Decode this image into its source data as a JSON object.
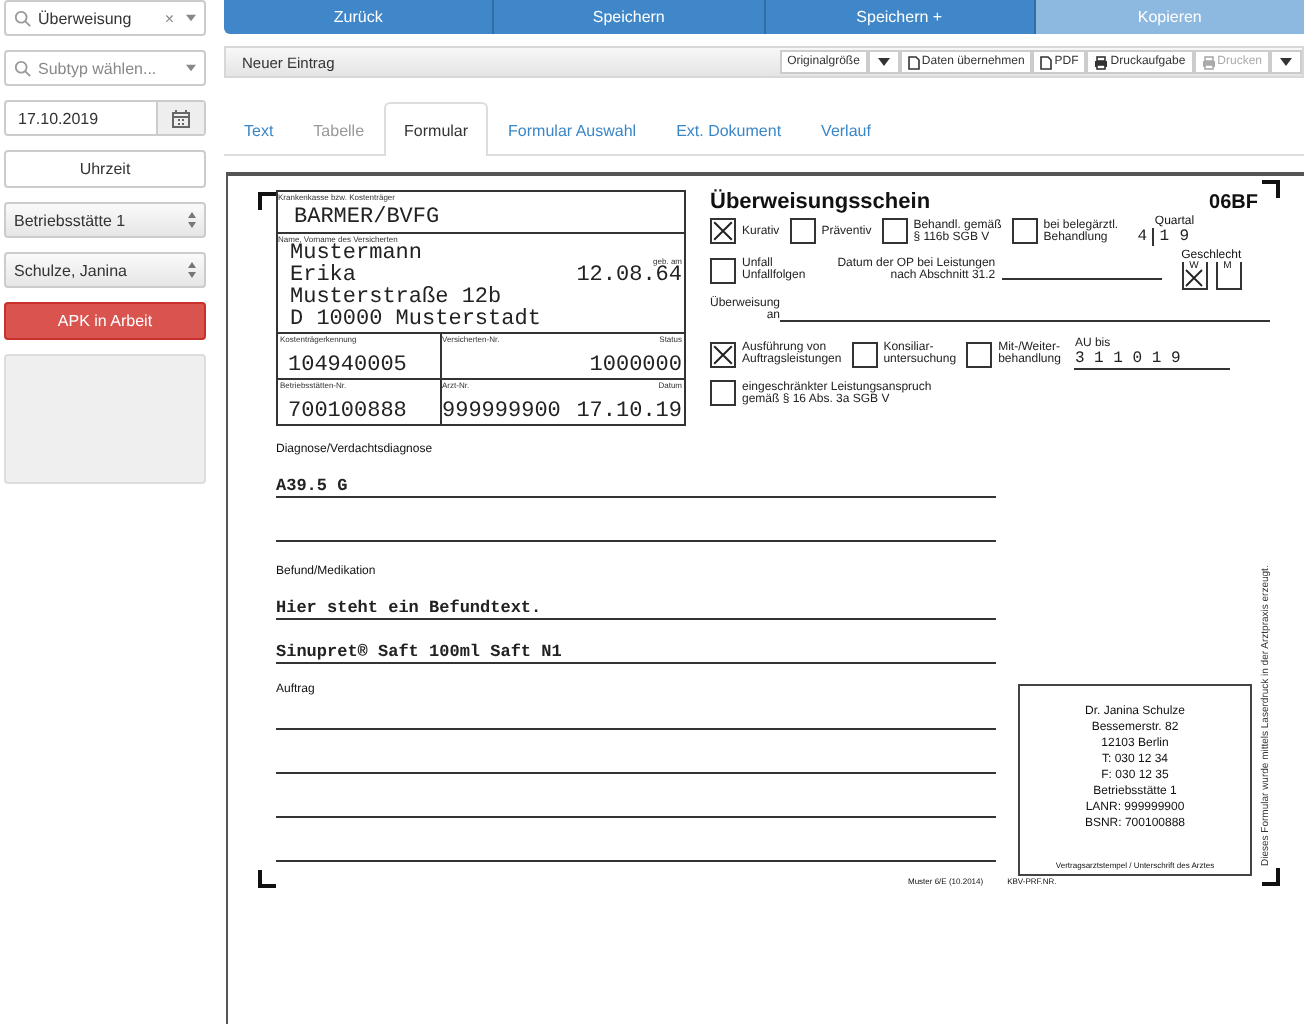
{
  "sidebar": {
    "type_select": {
      "value": "Überweisung",
      "clear": "×"
    },
    "subtype_select": {
      "placeholder": "Subtyp wählen..."
    },
    "date_field": {
      "value": "17.10.2019"
    },
    "time_button": "Uhrzeit",
    "location_select": "Betriebsstätte 1",
    "doctor_select": "Schulze, Janina",
    "status_button": "APK in Arbeit"
  },
  "action_buttons": [
    {
      "label": "Zurück",
      "disabled": false
    },
    {
      "label": "Speichern",
      "disabled": false
    },
    {
      "label": "Speichern +",
      "disabled": false
    },
    {
      "label": "Kopieren",
      "disabled": true
    }
  ],
  "toolbar": {
    "title": "Neuer Eintrag",
    "buttons": [
      {
        "label": "Originalgröße",
        "kind": "plain",
        "disabled": false
      },
      {
        "kind": "caret"
      },
      {
        "label": "Daten übernehmen",
        "kind": "document",
        "disabled": false
      },
      {
        "label": "PDF",
        "kind": "document",
        "disabled": false
      },
      {
        "label": "Druckaufgabe",
        "kind": "printer",
        "disabled": false
      },
      {
        "label": "Drucken",
        "kind": "printer",
        "disabled": true
      },
      {
        "kind": "caret"
      }
    ]
  },
  "tabs": [
    {
      "label": "Text",
      "selected": false,
      "disabled": false
    },
    {
      "label": "Tabelle",
      "selected": false,
      "disabled": true
    },
    {
      "label": "Formular",
      "selected": true,
      "disabled": false
    },
    {
      "label": "Formular Auswahl",
      "selected": false,
      "disabled": false
    },
    {
      "label": "Ext. Dokument",
      "selected": false,
      "disabled": false
    },
    {
      "label": "Verlauf",
      "selected": false,
      "disabled": false
    }
  ],
  "form": {
    "insurer_label": "Krankenkasse bzw. Kostenträger",
    "insurer": "BARMER/BVFG",
    "name_label": "Name, Vorname des Versicherten",
    "name_lines": [
      "Mustermann",
      "Erika",
      "Musterstraße 12b",
      "D 10000 Musterstadt"
    ],
    "dob_label": "geb. am",
    "dob": "12.08.64",
    "id_rows": [
      [
        {
          "label": "Kostenträgerkennung",
          "value": "104940005"
        },
        {
          "label": "Versicherten-Nr."
        },
        {
          "label": "Status",
          "value": "1000000"
        }
      ],
      [
        {
          "label": "Betriebsstätten-Nr.",
          "value": "700100888"
        },
        {
          "label": "Arzt-Nr.",
          "value": "999999900"
        },
        {
          "label": "Datum",
          "value": "17.10.19"
        }
      ]
    ],
    "title": "Überweisungsschein",
    "code": "06BF",
    "treatment": [
      {
        "label": "Kurativ",
        "checked": true
      },
      {
        "label": "Präventiv",
        "checked": false
      },
      {
        "label": "Behandl. gemäß\n§ 116b SGB V",
        "checked": false
      },
      {
        "label": "bei belegärztl.\nBehandlung",
        "checked": false
      }
    ],
    "quarter_label": "Quartal",
    "quarter": [
      "4",
      "1",
      "9"
    ],
    "accident": {
      "label": "Unfall\nUnfallfolgen",
      "checked": false
    },
    "op_date_label": "Datum der OP bei Leistungen\nnach Abschnitt 31.2",
    "gender_label": "Geschlecht",
    "gender": [
      {
        "label": "W",
        "checked": true
      },
      {
        "label": "M",
        "checked": false
      }
    ],
    "referral_label": "Überweisung\nan",
    "referral_type": [
      {
        "label": "Ausführung von\nAuftragsleistungen",
        "checked": true
      },
      {
        "label": "Konsiliar-\nuntersuchung",
        "checked": false
      },
      {
        "label": "Mit-/Weiter-\nbehandlung",
        "checked": false
      }
    ],
    "au_label": "AU bis",
    "au": "3 1 1 0 1 9",
    "restricted": {
      "label": "eingeschränkter Leistungsanspruch\ngemäß § 16 Abs. 3a SGB V",
      "checked": false
    },
    "diagnosis_label": "Diagnose/Verdachtsdiagnose",
    "diagnosis_lines": [
      "A39.5 G"
    ],
    "findings_label": "Befund/Medikation",
    "findings_lines": [
      "Hier steht ein Befundtext.",
      "Sinupret® Saft 100ml Saft N1"
    ],
    "order_label": "Auftrag",
    "stamp_lines": [
      "Dr. Janina Schulze",
      "Bessemerstr. 82",
      "12103 Berlin",
      "T: 030 12 34",
      "F: 030 12 35",
      "Betriebsstätte 1",
      "LANR: 999999900",
      "BSNR: 700100888"
    ],
    "stamp_caption": "Vertragsarztstempel / Unterschrift des Arztes",
    "form_version": "Muster 6/E (10.2014)",
    "prf_label": "KBV-PRF.NR.",
    "side_note": "Dieses Formular wurde mittels Laserdruck in der Arztpraxis erzeugt."
  }
}
